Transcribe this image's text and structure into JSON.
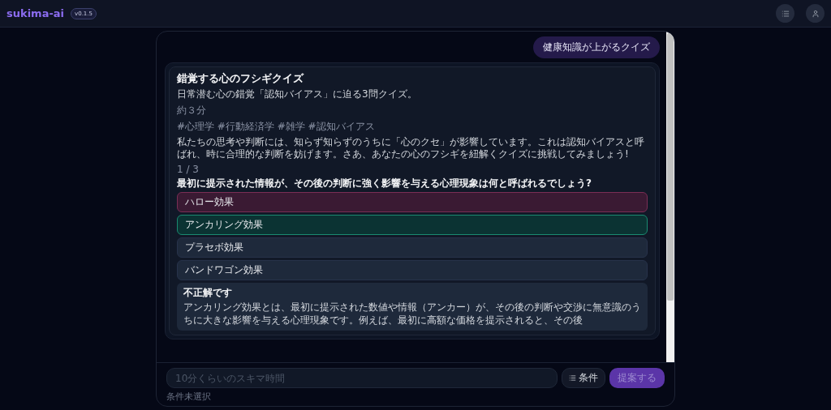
{
  "header": {
    "logo": "sukima-ai",
    "version": "v0.1.5"
  },
  "chat": {
    "user_message": "健康知識が上がるクイズ",
    "quiz": {
      "title": "錯覚する心のフシギクイズ",
      "subtitle": "日常潜む心の錯覚「認知バイアス」に迫る3問クイズ。",
      "duration": "約３分",
      "tags": "#心理学 #行動経済学 #雑学 #認知バイアス",
      "intro": "私たちの思考や判断には、知らず知らずのうちに「心のクセ」が影響しています。これは認知バイアスと呼ばれ、時に合理的な判断を妨げます。さあ、あなたの心のフシギを紐解くクイズに挑戦してみましょう!",
      "progress": "1 / 3",
      "question": "最初に提示された情報が、その後の判断に強く影響を与える心理現象は何と呼ばれるでしょう?",
      "options": [
        {
          "label": "ハロー効果",
          "kind": "wrong"
        },
        {
          "label": "アンカリング効果",
          "kind": "correct"
        },
        {
          "label": "プラセボ効果",
          "kind": "plain"
        },
        {
          "label": "バンドワゴン効果",
          "kind": "plain"
        }
      ],
      "feedback": {
        "title": "不正解です",
        "text": "アンカリング効果とは、最初に提示された数値や情報（アンカー）が、その後の判断や交渉に無意識のうちに大きな影響を与える心理現象です。例えば、最初に高額な価格を提示されると、その後"
      }
    }
  },
  "composer": {
    "placeholder": "10分くらいのスキマ時間",
    "conditions_button": "条件",
    "submit_button": "提案する",
    "conditions_status": "条件未選択"
  }
}
